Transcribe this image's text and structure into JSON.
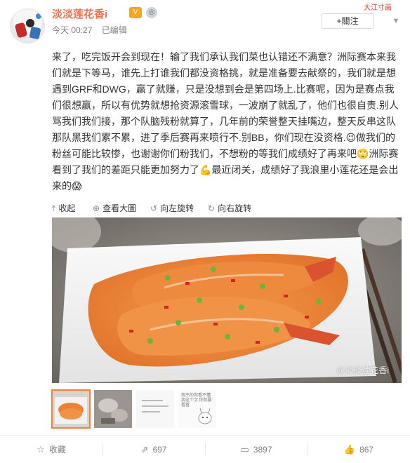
{
  "post": {
    "username": "淡淡莲花香i",
    "time": "今天 00:27",
    "edited": "已编辑",
    "follow_label": "+關注",
    "banner_text": "大江寸画",
    "text": "来了，吃完饭开会到现在！输了我们承认我们菜也认错还不满意？洲际赛本来我们就是下等马，谁先上打谁我们都没资格挑，就是准备要去献祭的，我们就是想遇到GRF和DWG，赢了就赚，只是没想到会是第四场上.比赛呢，因为是赛点我们很想赢，所以有优势就想抢资源滚雪球，一波崩了就乱了，他们也很自责.别人骂我们我们接，那个队脑残粉就算了，几年前的荣誉整天挂嘴边，整天反串这队那队黑我们累不累，进了季后赛再来喷行不.别BB，你们现在没资格.😉做我们的粉丝可能比较惨，也谢谢你们粉我们，不想粉的等我们成绩好了再来吧🙄洲际赛看到了我们的差距只能更加努力了💪最近闭关，成绩好了我浪里小莲花还是会出来的😱"
  },
  "media_toolbar": {
    "collapse": "收起",
    "view_large": "查看大圖",
    "rotate_left": "向左旋转",
    "rotate_right": "向右旋转"
  },
  "image": {
    "watermark": "@淡淡莲花香i"
  },
  "thumbnails": {
    "note_text": "努杰的你看不懂我这个字 你就要看看"
  },
  "actions": {
    "favorite": "收藏",
    "repost": "697",
    "comment": "3897",
    "like": "867"
  },
  "colors": {
    "accent": "#eb7350",
    "thumb_border": "#fa7d3c"
  }
}
